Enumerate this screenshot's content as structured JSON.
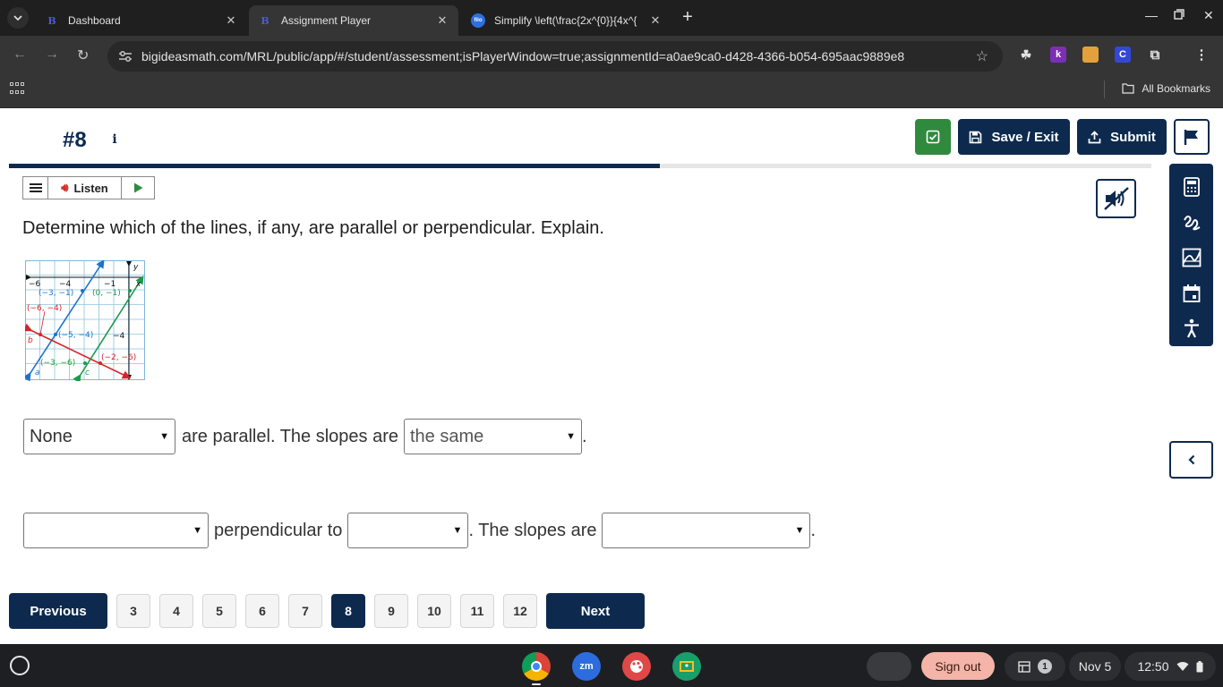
{
  "browser": {
    "tabs": [
      {
        "title": "Dashboard",
        "favicon": "B"
      },
      {
        "title": "Assignment Player",
        "favicon": "B"
      },
      {
        "title": "Simplify \\left(\\frac{2x^{0}}{4x^{",
        "favicon": "filo"
      }
    ],
    "url": "bigideasmath.com/MRL/public/app/#/student/assessment;isPlayerWindow=true;assignmentId=a0ae9ca0-d428-4366-b054-695aac9889e8",
    "extensions": [
      "k",
      "C"
    ],
    "bookmarks_label": "All Bookmarks"
  },
  "header": {
    "question_number": "#8",
    "info_icon": "i",
    "save_exit_label": "Save / Exit",
    "submit_label": "Submit",
    "progress": 0.57
  },
  "listen_bar": {
    "listen_label": "Listen"
  },
  "question": {
    "prompt": "Determine which of the lines, if any, are parallel or perpendicular. Explain."
  },
  "graph": {
    "x_ticks": [
      "−6",
      "−4",
      "−1"
    ],
    "y_ticks": [
      "−4"
    ],
    "x_axis_label": "x",
    "y_axis_label": "y",
    "points": {
      "p1": "(−3, −1)",
      "p2": "(0, −1)",
      "p3": "(−6, −4)",
      "p4": "(−5, −4)",
      "p5": "(−3, −6)",
      "p6": "(−2, −6)"
    },
    "line_labels": {
      "a": "a",
      "b": "b",
      "c": "c"
    },
    "colors": {
      "a": "#1a73c9",
      "b": "#d6242b",
      "c": "#1f9a4a"
    }
  },
  "answers": {
    "row1": {
      "select1_value": "None",
      "text1": "are parallel. The slopes are",
      "select2_value": "the same",
      "end": "."
    },
    "row2": {
      "select1_value": "",
      "text1": "perpendicular to",
      "select2_value": "",
      "text2": ". The slopes are",
      "select3_value": "",
      "end": "."
    }
  },
  "pager": {
    "previous_label": "Previous",
    "next_label": "Next",
    "pages": [
      "3",
      "4",
      "5",
      "6",
      "7",
      "8",
      "9",
      "10",
      "11",
      "12"
    ],
    "current": "8"
  },
  "shelf": {
    "apps": [
      "chrome",
      "zm",
      "paint",
      "classroom"
    ],
    "zoom_label": "zm",
    "signout_label": "Sign out",
    "notification_count": "1",
    "date": "Nov 5",
    "time": "12:50"
  }
}
